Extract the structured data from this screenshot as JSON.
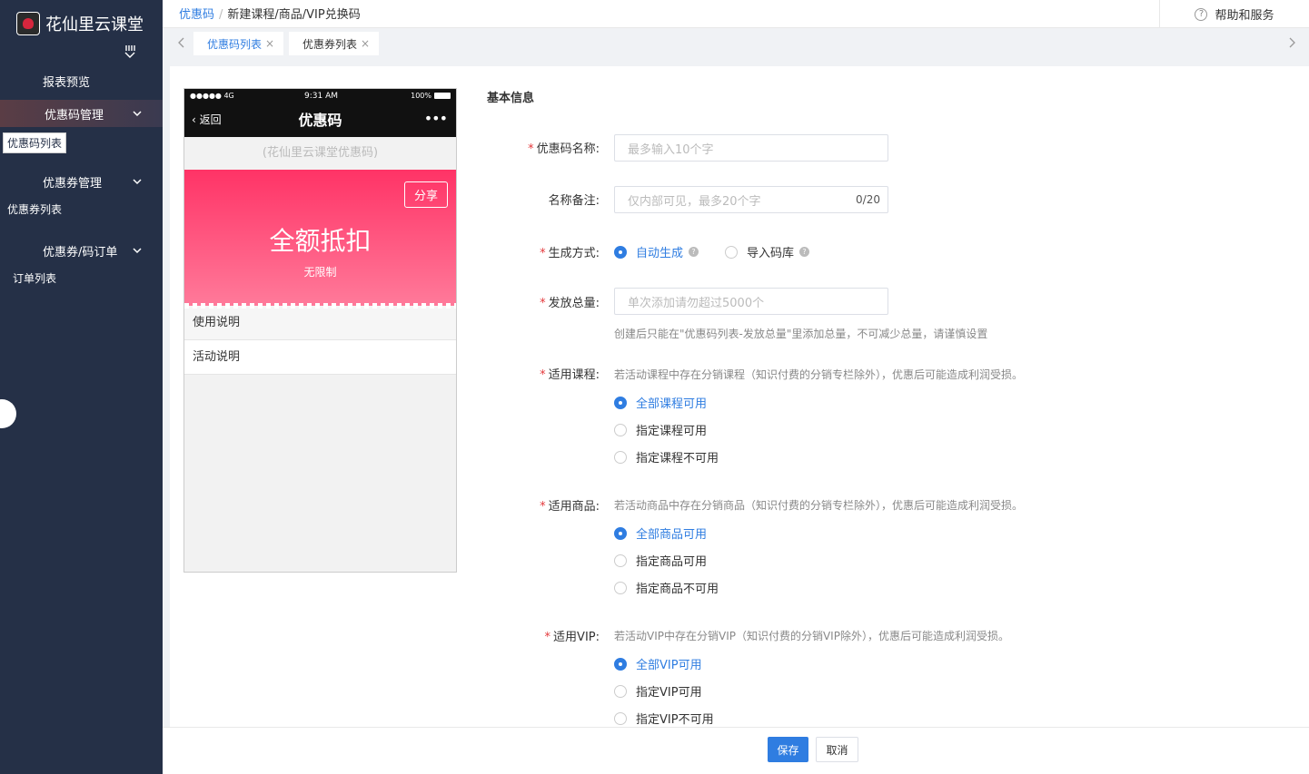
{
  "sidebar": {
    "brand": "花仙里云课堂",
    "report_preview": "报表预览",
    "groups": [
      {
        "label": "优惠码管理",
        "sub": "优惠码列表"
      },
      {
        "label": "优惠券管理",
        "sub": "优惠券列表"
      },
      {
        "label": "优惠券/码订单",
        "sub": "订单列表"
      }
    ]
  },
  "header": {
    "breadcrumb": [
      "优惠码",
      "新建课程/商品/VIP兑换码"
    ],
    "breadcrumb_sep": "/",
    "help_label": "帮助和服务"
  },
  "tabs": [
    {
      "label": "优惠码列表",
      "close": "×"
    },
    {
      "label": "优惠券列表",
      "close": "×"
    }
  ],
  "phone": {
    "signal": "●●●●● 4G",
    "time": "9:31 AM",
    "battery": "100%",
    "back": "返回",
    "title": "优惠码",
    "more": "•••",
    "shop_hint": "(花仙里云课堂优惠码)",
    "share": "分享",
    "amount": "全额抵扣",
    "limit": "无限制",
    "rows": [
      "使用说明",
      "活动说明"
    ]
  },
  "form": {
    "section": "基本信息",
    "name": {
      "label": "优惠码名称:",
      "placeholder": "最多输入10个字"
    },
    "remark": {
      "label": "名称备注:",
      "placeholder": "仅内部可见，最多20个字",
      "counter": "0/20"
    },
    "gen": {
      "label": "生成方式:",
      "options": [
        "自动生成",
        "导入码库"
      ],
      "selected": 0
    },
    "total": {
      "label": "发放总量:",
      "placeholder": "单次添加请勿超过5000个",
      "hint": "创建后只能在\"优惠码列表-发放总量\"里添加总量，不可减少总量，请谨慎设置"
    },
    "course": {
      "label": "适用课程:",
      "hint": "若活动课程中存在分销课程（知识付费的分销专栏除外），优惠后可能造成利润受损。",
      "options": [
        "全部课程可用",
        "指定课程可用",
        "指定课程不可用"
      ],
      "selected": 0
    },
    "goods": {
      "label": "适用商品:",
      "hint": "若活动商品中存在分销商品（知识付费的分销专栏除外），优惠后可能造成利润受损。",
      "options": [
        "全部商品可用",
        "指定商品可用",
        "指定商品不可用"
      ],
      "selected": 0
    },
    "vip": {
      "label": "适用VIP:",
      "hint": "若活动VIP中存在分销VIP（知识付费的分销VIP除外），优惠后可能造成利润受损。",
      "options": [
        "全部VIP可用",
        "指定VIP可用",
        "指定VIP不可用"
      ],
      "selected": 0
    },
    "required_mark": "*",
    "help_mark": "?"
  },
  "footer": {
    "save": "保存",
    "cancel": "取消"
  },
  "colors": {
    "sidebar": "#253047",
    "accent": "#2f7de1",
    "card_top": "#ff3366",
    "card_bottom": "#ff7a9a",
    "required": "#e4393c"
  }
}
